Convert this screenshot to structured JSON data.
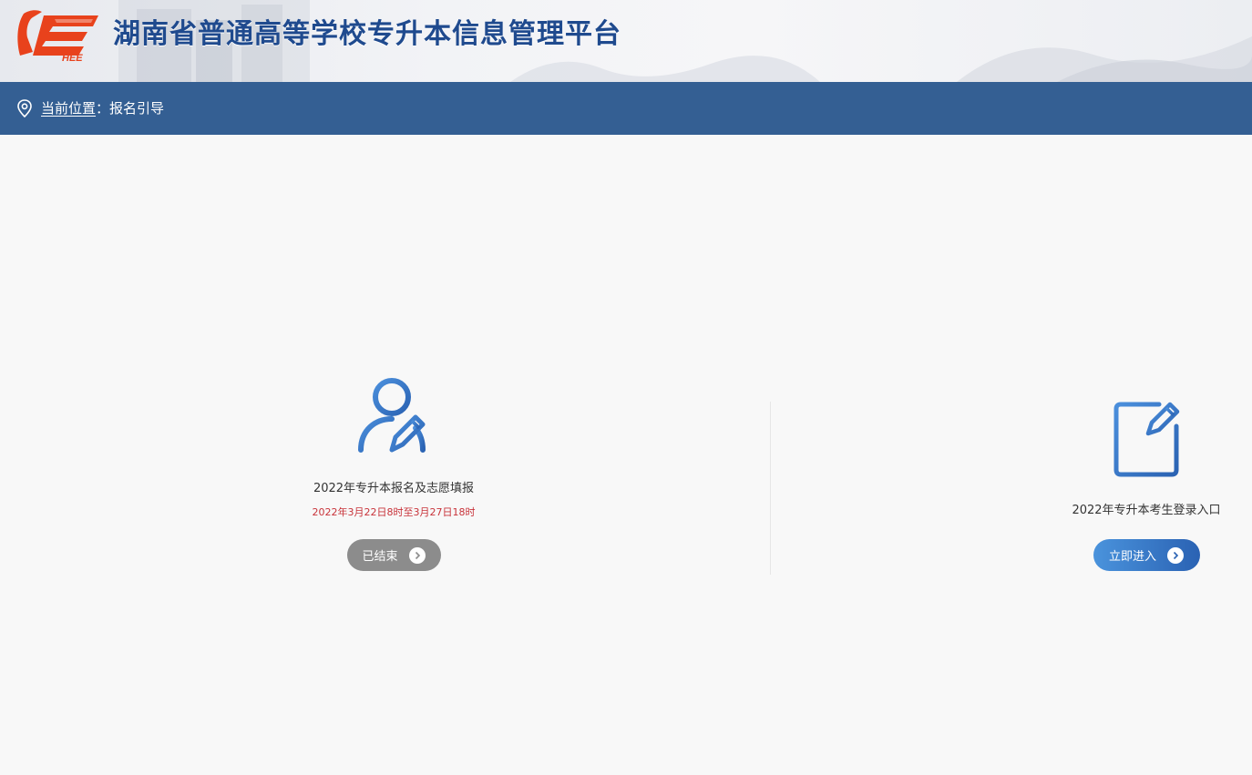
{
  "header": {
    "logo_text": "HEE",
    "title": "湖南省普通高等学校专升本信息管理平台"
  },
  "breadcrumb": {
    "prefix": "当前位置",
    "separator": "：",
    "current": "报名引导"
  },
  "cards": [
    {
      "icon": "user-edit-icon",
      "title": "2022年专升本报名及志愿填报",
      "date": "2022年3月22日8时至3月27日18时",
      "button_label": "已结束",
      "button_color": "#8c8c8c"
    },
    {
      "icon": "form-edit-icon",
      "title": "2022年专升本考生登录入口",
      "button_label": "立即进入",
      "button_color": "#2a62b3"
    }
  ],
  "colors": {
    "breadcrumb_bar": "#345f93",
    "title": "#1f4a8e",
    "date_red": "#c8333a",
    "icon_blue": "#3a78c6"
  }
}
